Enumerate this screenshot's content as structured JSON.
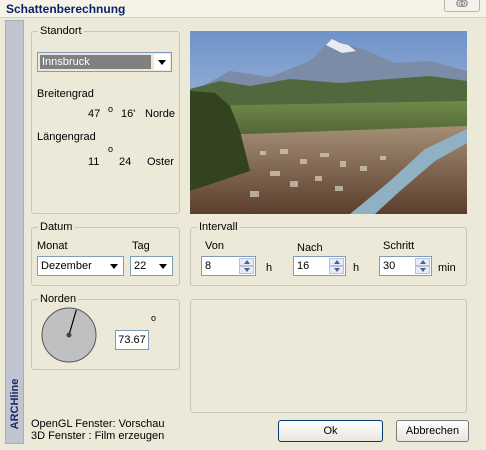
{
  "window": {
    "title": "Schattenberechnung",
    "close_glyph": "ↂ"
  },
  "sidebar": {
    "brand": "ARCHline"
  },
  "standort": {
    "legend": "Standort",
    "city": "Innsbruck",
    "breitengrad": {
      "label": "Breitengrad",
      "deg": "47",
      "deg_sym": "o",
      "min": "16'",
      "dir": "Norde"
    },
    "laengengrad": {
      "label": "Längengrad",
      "deg": "11",
      "deg_sym": "o",
      "min": "24",
      "dir": "Oster"
    }
  },
  "datum": {
    "legend": "Datum",
    "monat_label": "Monat",
    "monat": "Dezember",
    "tag_label": "Tag",
    "tag": "22"
  },
  "intervall": {
    "legend": "Intervall",
    "von": {
      "label": "Von",
      "value": "8",
      "unit": "h"
    },
    "nach": {
      "label": "Nach",
      "value": "16",
      "unit": "h"
    },
    "schritt": {
      "label": "Schritt",
      "value": "30",
      "unit": "min"
    }
  },
  "norden": {
    "legend": "Norden",
    "value": "73.67",
    "deg_sym": "o"
  },
  "footer": {
    "line1": "OpenGL Fenster: Vorschau",
    "line2": "3D Fenster : Film erzeugen",
    "ok_label": "Ok",
    "cancel_label": "Abbrechen"
  },
  "colors": {
    "title": "#0a246a",
    "accent_border": "#7f9db9",
    "button_border": "#003c74"
  }
}
